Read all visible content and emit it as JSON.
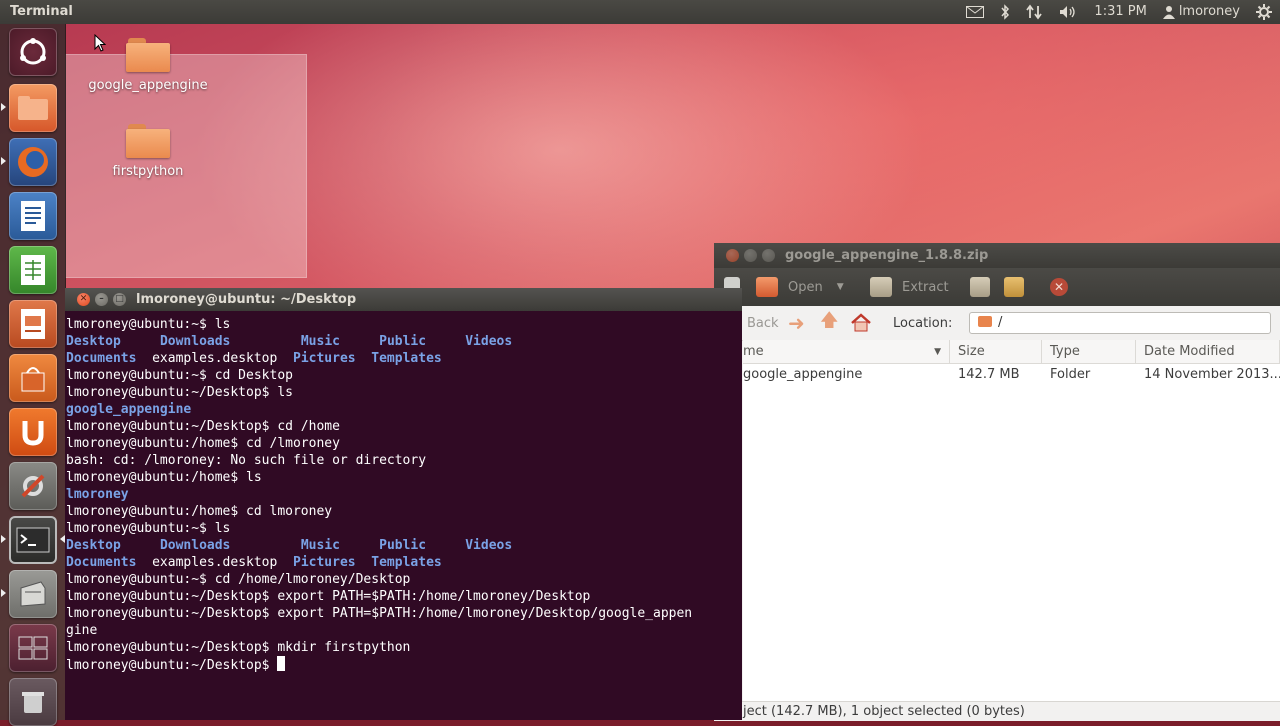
{
  "top_panel": {
    "app_title": "Terminal",
    "time": "1:31 PM",
    "user": "lmoroney",
    "icons": [
      "mail-icon",
      "bluetooth-icon",
      "network-icon",
      "volume-icon",
      "user-icon",
      "gear-icon"
    ]
  },
  "launcher": {
    "items": [
      "dash-home-icon",
      "files-icon",
      "firefox-icon",
      "writer-icon",
      "calc-icon",
      "impress-icon",
      "software-center-icon",
      "ubuntu-one-icon",
      "system-settings-icon",
      "terminal-icon",
      "archive-manager-icon",
      "workspace-switcher-icon",
      "trash-icon"
    ]
  },
  "desktop": {
    "icons": [
      {
        "label": "google_appengine"
      },
      {
        "label": "firstpython"
      }
    ]
  },
  "terminal": {
    "title": "lmoroney@ubuntu: ~/Desktop",
    "lines": [
      {
        "segments": [
          {
            "t": "lmoroney@ubuntu:~$ ls",
            "c": "w"
          }
        ]
      },
      {
        "segments": [
          {
            "t": "Desktop   ",
            "c": "b"
          },
          {
            "t": "  ",
            "c": "w"
          },
          {
            "t": "Downloads",
            "c": "b"
          },
          {
            "t": "         ",
            "c": "w"
          },
          {
            "t": "Music",
            "c": "b"
          },
          {
            "t": "     ",
            "c": "w"
          },
          {
            "t": "Public",
            "c": "b"
          },
          {
            "t": "     ",
            "c": "w"
          },
          {
            "t": "Videos",
            "c": "b"
          }
        ]
      },
      {
        "segments": [
          {
            "t": "Documents",
            "c": "b"
          },
          {
            "t": "  examples.desktop  ",
            "c": "w"
          },
          {
            "t": "Pictures",
            "c": "b"
          },
          {
            "t": "  ",
            "c": "w"
          },
          {
            "t": "Templates",
            "c": "b"
          }
        ]
      },
      {
        "segments": [
          {
            "t": "lmoroney@ubuntu:~$ cd Desktop",
            "c": "w"
          }
        ]
      },
      {
        "segments": [
          {
            "t": "lmoroney@ubuntu:~/Desktop$ ls",
            "c": "w"
          }
        ]
      },
      {
        "segments": [
          {
            "t": "google_appengine",
            "c": "b"
          }
        ]
      },
      {
        "segments": [
          {
            "t": "lmoroney@ubuntu:~/Desktop$ cd /home",
            "c": "w"
          }
        ]
      },
      {
        "segments": [
          {
            "t": "lmoroney@ubuntu:/home$ cd /lmoroney",
            "c": "w"
          }
        ]
      },
      {
        "segments": [
          {
            "t": "bash: cd: /lmoroney: No such file or directory",
            "c": "w"
          }
        ]
      },
      {
        "segments": [
          {
            "t": "lmoroney@ubuntu:/home$ ls",
            "c": "w"
          }
        ]
      },
      {
        "segments": [
          {
            "t": "lmoroney",
            "c": "b"
          }
        ]
      },
      {
        "segments": [
          {
            "t": "lmoroney@ubuntu:/home$ cd lmoroney",
            "c": "w"
          }
        ]
      },
      {
        "segments": [
          {
            "t": "lmoroney@ubuntu:~$ ls",
            "c": "w"
          }
        ]
      },
      {
        "segments": [
          {
            "t": "Desktop   ",
            "c": "b"
          },
          {
            "t": "  ",
            "c": "w"
          },
          {
            "t": "Downloads",
            "c": "b"
          },
          {
            "t": "         ",
            "c": "w"
          },
          {
            "t": "Music",
            "c": "b"
          },
          {
            "t": "     ",
            "c": "w"
          },
          {
            "t": "Public",
            "c": "b"
          },
          {
            "t": "     ",
            "c": "w"
          },
          {
            "t": "Videos",
            "c": "b"
          }
        ]
      },
      {
        "segments": [
          {
            "t": "Documents",
            "c": "b"
          },
          {
            "t": "  examples.desktop  ",
            "c": "w"
          },
          {
            "t": "Pictures",
            "c": "b"
          },
          {
            "t": "  ",
            "c": "w"
          },
          {
            "t": "Templates",
            "c": "b"
          }
        ]
      },
      {
        "segments": [
          {
            "t": "lmoroney@ubuntu:~$ cd /home/lmoroney/Desktop",
            "c": "w"
          }
        ]
      },
      {
        "segments": [
          {
            "t": "lmoroney@ubuntu:~/Desktop$ export PATH=$PATH:/home/lmoroney/Desktop",
            "c": "w"
          }
        ]
      },
      {
        "segments": [
          {
            "t": "lmoroney@ubuntu:~/Desktop$ export PATH=$PATH:/home/lmoroney/Desktop/google_appen",
            "c": "w"
          }
        ]
      },
      {
        "segments": [
          {
            "t": "gine",
            "c": "w"
          }
        ]
      },
      {
        "segments": [
          {
            "t": "lmoroney@ubuntu:~/Desktop$ mkdir firstpython",
            "c": "w"
          }
        ]
      },
      {
        "segments": [
          {
            "t": "lmoroney@ubuntu:~/Desktop$ ",
            "c": "w"
          }
        ],
        "cursor": true
      }
    ]
  },
  "archive": {
    "title": "google_appengine_1.8.8.zip",
    "toolbar": {
      "open_label": "Open",
      "extract_label": "Extract"
    },
    "nav": {
      "back_label": "Back",
      "location_label": "Location:",
      "location_value": "/"
    },
    "columns": [
      "me",
      "Size",
      "Type",
      "Date Modified"
    ],
    "rows": [
      {
        "name": "google_appengine",
        "size": "142.7 MB",
        "type": "Folder",
        "date": "14 November 2013..."
      }
    ],
    "status": "ject (142.7 MB), 1 object selected (0 bytes)"
  },
  "colors": {
    "terminal_bg": "#300a24",
    "terminal_dir": "#7aa2e6",
    "panel": "#3c3b37",
    "close_button": "#e0471d"
  }
}
